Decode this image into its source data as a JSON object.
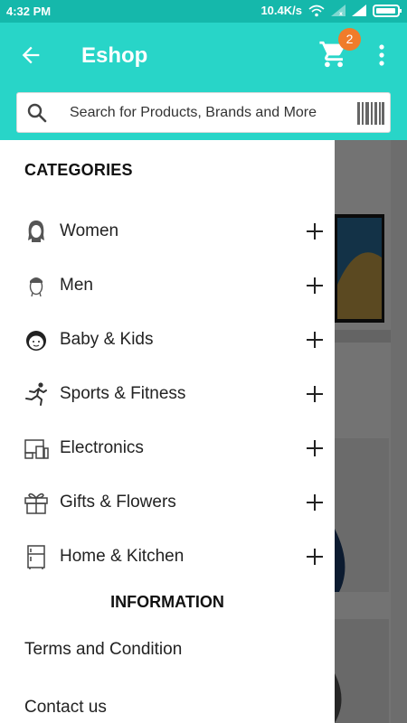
{
  "status_bar": {
    "time": "4:32 PM",
    "net_speed": "10.4K/s",
    "icons": [
      "wifi-icon",
      "signal-icon",
      "signal-icon",
      "battery-icon"
    ]
  },
  "app_bar": {
    "title": "Eshop",
    "cart_count": "2",
    "icons": [
      "back-arrow-icon",
      "cart-icon",
      "more-vert-icon"
    ],
    "accent_color": "#28d5c8",
    "badge_color": "#f07c2a"
  },
  "search": {
    "placeholder": "Search for Products, Brands and More",
    "icons": [
      "search-icon",
      "barcode-icon"
    ]
  },
  "drawer": {
    "categories_title": "CATEGORIES",
    "categories": [
      {
        "label": "Women",
        "icon": "woman-icon"
      },
      {
        "label": "Men",
        "icon": "man-icon"
      },
      {
        "label": "Baby & Kids",
        "icon": "baby-icon"
      },
      {
        "label": "Sports & Fitness",
        "icon": "runner-icon"
      },
      {
        "label": "Electronics",
        "icon": "devices-icon"
      },
      {
        "label": "Gifts & Flowers",
        "icon": "gift-icon"
      },
      {
        "label": "Home & Kitchen",
        "icon": "fridge-icon"
      }
    ],
    "information_title": "INFORMATION",
    "information_links": [
      "Terms and Condition",
      "Contact us"
    ]
  }
}
